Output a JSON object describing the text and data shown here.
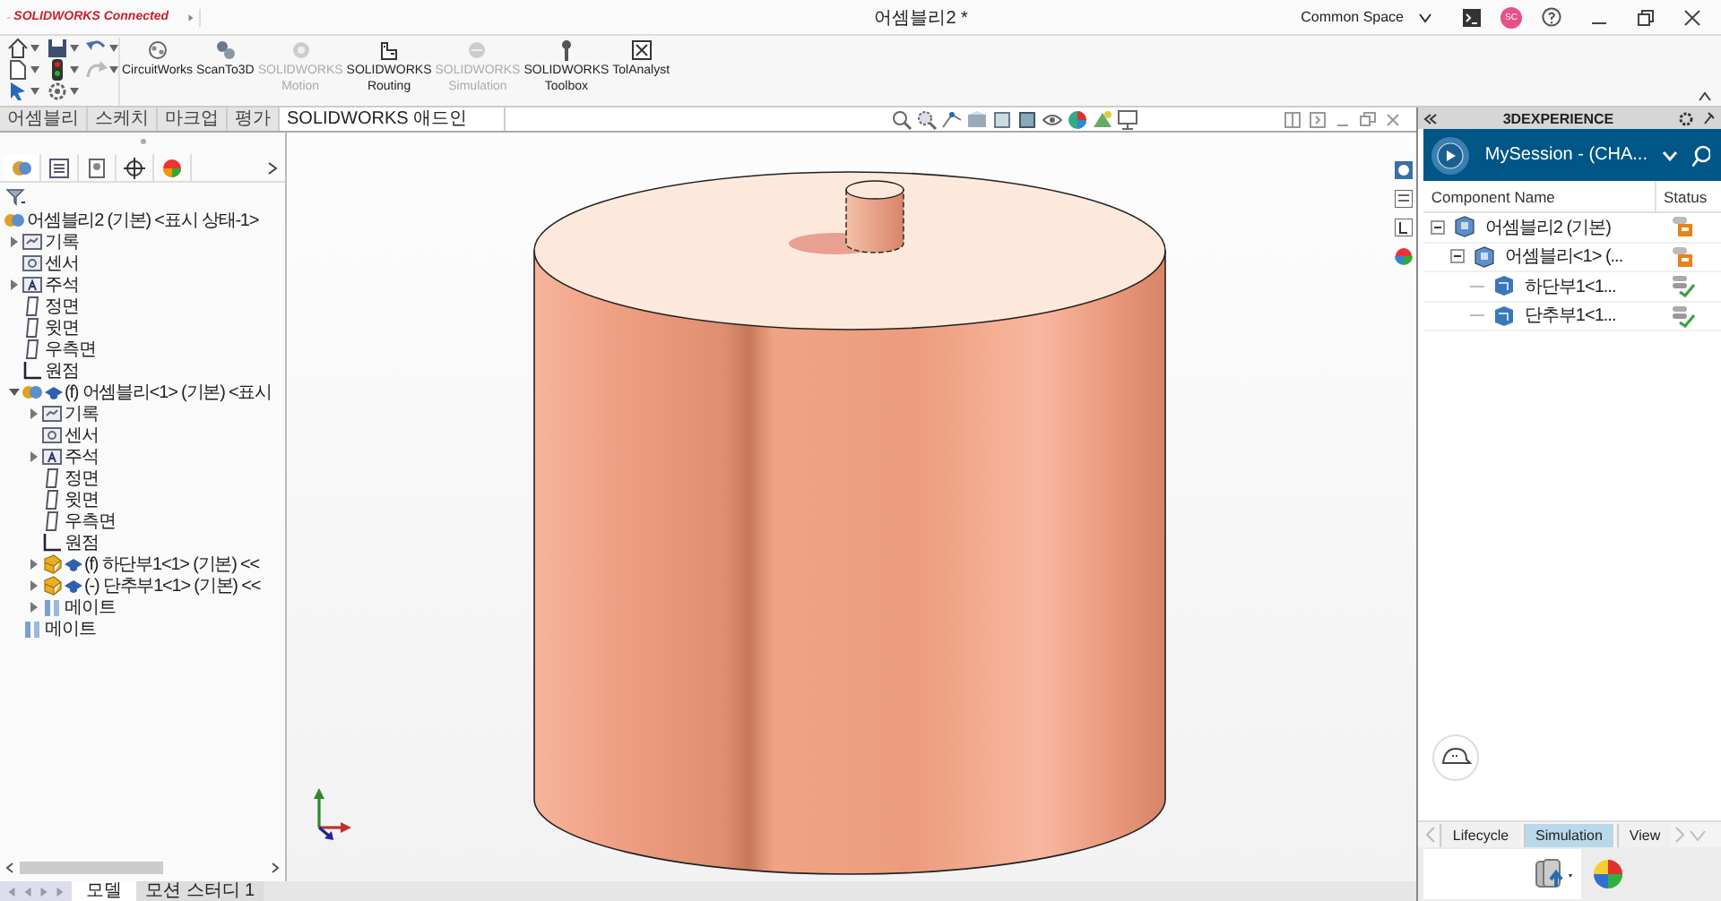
{
  "title_bar": {
    "brand": "SOLIDWORKS Connected",
    "document_title": "어셈블리2 *",
    "workspace": "Common Space",
    "avatar_initials": "SC"
  },
  "toolbar": {
    "tools": [
      {
        "lines": [
          "CircuitWorks"
        ],
        "kind": "circuit",
        "disabled": false
      },
      {
        "lines": [
          "ScanTo3D"
        ],
        "kind": "scan",
        "disabled": false
      },
      {
        "lines": [
          "SOLIDWORKS",
          "Motion"
        ],
        "kind": "motion",
        "disabled": true
      },
      {
        "lines": [
          "SOLIDWORKS",
          "Routing"
        ],
        "kind": "routing",
        "disabled": false
      },
      {
        "lines": [
          "SOLIDWORKS",
          "Simulation"
        ],
        "kind": "simulation",
        "disabled": true
      },
      {
        "lines": [
          "SOLIDWORKS",
          "Toolbox"
        ],
        "kind": "toolbox",
        "disabled": false
      },
      {
        "lines": [
          "TolAnalyst"
        ],
        "kind": "tolerance",
        "disabled": false
      }
    ]
  },
  "command_tabs": [
    {
      "label": "어셈블리",
      "selected": false
    },
    {
      "label": "스케치",
      "selected": false
    },
    {
      "label": "마크업",
      "selected": false
    },
    {
      "label": "평가",
      "selected": false
    },
    {
      "label": "SOLIDWORKS 애드인",
      "selected": true
    }
  ],
  "feature_tree": {
    "items": [
      {
        "label": "어셈블리2 (기본) <표시 상태-1>",
        "kind": "assembly",
        "children": [
          {
            "label": "기록",
            "kind": "history",
            "expanded": false
          },
          {
            "label": "센서",
            "kind": "sensor"
          },
          {
            "label": "주석",
            "kind": "annotation",
            "expanded": false
          },
          {
            "label": "정면",
            "kind": "plane"
          },
          {
            "label": "윗면",
            "kind": "plane"
          },
          {
            "label": "우측면",
            "kind": "plane"
          },
          {
            "label": "원점",
            "kind": "origin"
          },
          {
            "label": "(f) 어셈블리<1> (기본) <표시",
            "kind": "assembly",
            "expanded": true,
            "children": [
              {
                "label": "기록",
                "kind": "history",
                "expanded": false
              },
              {
                "label": "센서",
                "kind": "sensor"
              },
              {
                "label": "주석",
                "kind": "annotation",
                "expanded": false
              },
              {
                "label": "정면",
                "kind": "plane"
              },
              {
                "label": "윗면",
                "kind": "plane"
              },
              {
                "label": "우측면",
                "kind": "plane"
              },
              {
                "label": "원점",
                "kind": "origin"
              },
              {
                "label": "(f) 하단부1<1> (기본) <<",
                "kind": "part",
                "expanded": false
              },
              {
                "label": "(-) 단추부1<1> (기본) <<",
                "kind": "part",
                "expanded": false
              },
              {
                "label": "메이트",
                "kind": "mates",
                "expanded": false
              }
            ]
          },
          {
            "label": "메이트",
            "kind": "mates"
          }
        ]
      }
    ]
  },
  "bottom_tabs": [
    {
      "label": "모델",
      "selected": true
    },
    {
      "label": "모션 스터디 1",
      "selected": false
    }
  ],
  "panel": {
    "title": "3DEXPERIENCE",
    "session": "MySession - (CHA...",
    "columns": [
      "Component Name",
      "Status"
    ],
    "rows": [
      {
        "name": "어셈블리2 (기본)",
        "kind": "assembly",
        "locked": true,
        "expanded": true,
        "children": [
          {
            "name": "어셈블리<1> (...",
            "kind": "assembly",
            "locked": true,
            "expanded": true,
            "children": [
              {
                "name": "하단부1<1...",
                "kind": "part",
                "locked": false
              },
              {
                "name": "단추부1<1...",
                "kind": "part",
                "locked": false
              }
            ]
          }
        ]
      }
    ],
    "tabs": [
      {
        "label": "Lifecycle",
        "selected": false
      },
      {
        "label": "Simulation",
        "selected": true
      },
      {
        "label": "View",
        "selected": false
      }
    ]
  }
}
